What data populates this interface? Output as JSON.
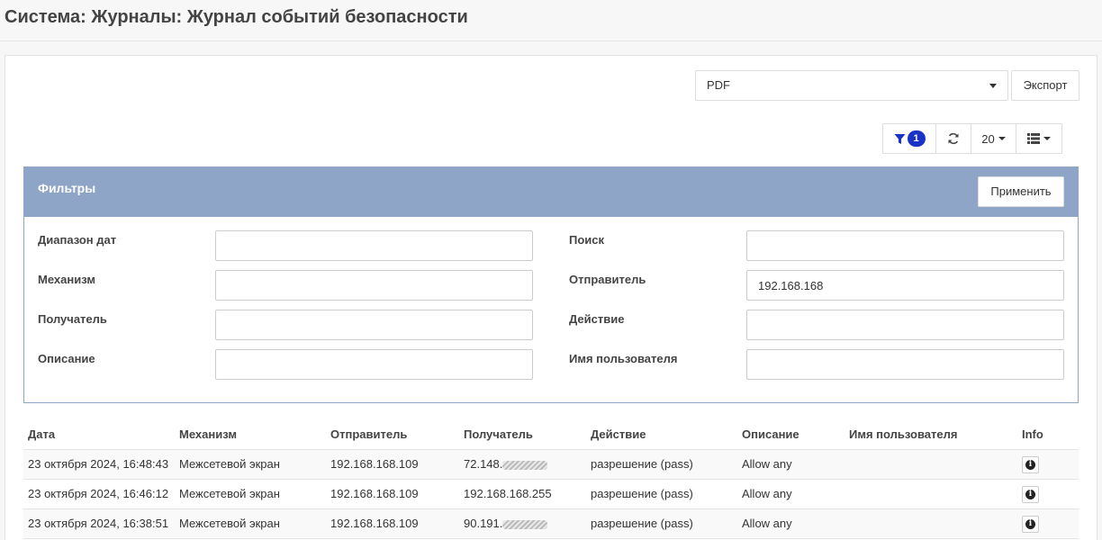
{
  "page": {
    "title": "Система: Журналы: Журнал событий безопасности"
  },
  "export": {
    "format_value": "PDF",
    "button_label": "Экспорт"
  },
  "toolbar": {
    "filter_count": "1",
    "page_size": "20",
    "icons": [
      "filter-icon",
      "refresh-icon",
      "list-columns-icon"
    ]
  },
  "filters": {
    "title": "Фильтры",
    "apply_label": "Применить",
    "fields": {
      "date_range": {
        "label": "Диапазон дат",
        "value": ""
      },
      "search": {
        "label": "Поиск",
        "value": ""
      },
      "mechanism": {
        "label": "Механизм",
        "value": ""
      },
      "sender": {
        "label": "Отправитель",
        "value": "192.168.168"
      },
      "recipient": {
        "label": "Получатель",
        "value": ""
      },
      "action": {
        "label": "Действие",
        "value": ""
      },
      "description": {
        "label": "Описание",
        "value": ""
      },
      "username": {
        "label": "Имя пользователя",
        "value": ""
      }
    }
  },
  "table": {
    "columns": [
      "Дата",
      "Механизм",
      "Отправитель",
      "Получатель",
      "Действие",
      "Описание",
      "Имя пользователя",
      "Info"
    ],
    "rows": [
      {
        "date": "23 октября 2024, 16:48:43",
        "mechanism": "Межсетевой экран",
        "sender": "192.168.168.109",
        "recipient": "72.148.",
        "recipient_masked": true,
        "action": "разрешение (pass)",
        "description": "Allow any",
        "username": ""
      },
      {
        "date": "23 октября 2024, 16:46:12",
        "mechanism": "Межсетевой экран",
        "sender": "192.168.168.109",
        "recipient": "192.168.168.255",
        "recipient_masked": false,
        "action": "разрешение (pass)",
        "description": "Allow any",
        "username": ""
      },
      {
        "date": "23 октября 2024, 16:38:51",
        "mechanism": "Межсетевой экран",
        "sender": "192.168.168.109",
        "recipient": "90.191.",
        "recipient_masked": true,
        "action": "разрешение (pass)",
        "description": "Allow any",
        "username": ""
      }
    ]
  },
  "colors": {
    "panel_header": "#8ea5c8",
    "badge": "#1a33c6"
  }
}
